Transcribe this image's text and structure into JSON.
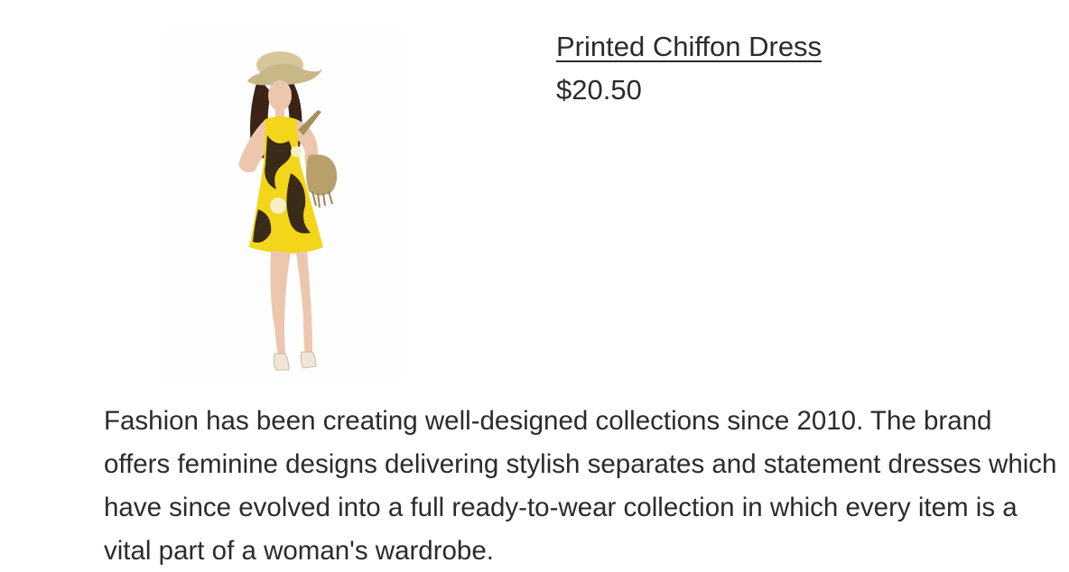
{
  "product": {
    "name": "Printed Chiffon Dress",
    "price": "$20.50",
    "description": "Fashion has been creating well-designed collections since 2010. The brand offers feminine designs delivering stylish separates and statement dresses which have since evolved into a full ready-to-wear collection in which every item is a vital part of a woman's wardrobe."
  },
  "colors": {
    "text": "#2b2b2b",
    "dress_yellow": "#f3d51a",
    "dress_dark": "#3a2a1a",
    "hat": "#d6c79a",
    "bag": "#b7a06a",
    "skin": "#ecc7ad",
    "hair": "#3b2416"
  }
}
